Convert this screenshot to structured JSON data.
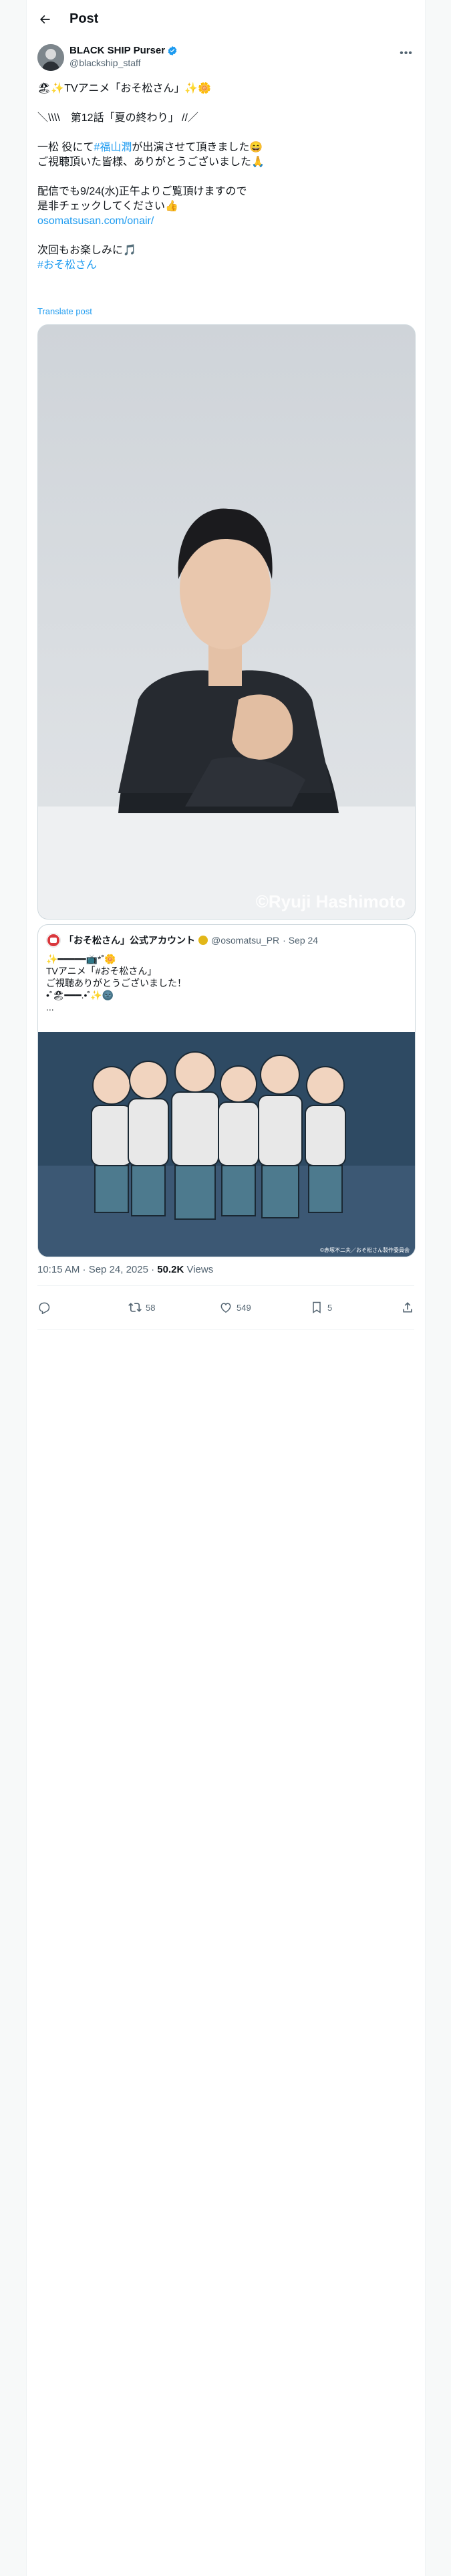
{
  "header": {
    "title": "Post"
  },
  "author": {
    "display_name": "BLACK SHIP Purser",
    "handle": "@blackship_staff",
    "avatar_icon": "profile-photo"
  },
  "post": {
    "lines": [
      "🏖✨TVアニメ「おそ松さん」✨🌼",
      "",
      "＼\\\\\\\\　第12話「夏の終わり」 //／",
      "",
      "一松 役にて",
      "ご視聴頂いた皆様、ありがとうございました🙏",
      "",
      "配信でも9/24(水)正午よりご覧頂けますので",
      "是非チェックしてください👍",
      "",
      "",
      "次回もお楽しみに🎵",
      ""
    ],
    "line5_prefix": "一松 役にて",
    "line5_link": "#福山潤",
    "line5_suffix": "が出演させて頂きました😄",
    "url": "osomatsusan.com/onair/",
    "hashtag": "#おそ松さん",
    "translate": "Translate post",
    "photo_watermark": "©Ryuji Hashimoto"
  },
  "quote": {
    "name": "「おそ松さん」公式アカウント",
    "handle": "@osomatsu_PR",
    "date": "· Sep 24",
    "text": "✨━━━━━📺*˚🌼\nTVアニメ「#おそ松さん」\nご視聴ありがとうございました！\n•˚🏖━━━.•˚✨🌚\n...",
    "image_caption": "©赤塚不二夫／おそ松さん製作委員会"
  },
  "meta": {
    "time": "10:15 AM · Sep 24, 2025 · ",
    "views": "50.2K",
    "views_label": " Views"
  },
  "actions": {
    "reply_count": "",
    "repost_count": "58",
    "like_count": "549",
    "bookmark_count": "5"
  },
  "colors": {
    "accent": "#1d9bf0",
    "secondary_text": "#536471",
    "border": "#cfd9de"
  }
}
